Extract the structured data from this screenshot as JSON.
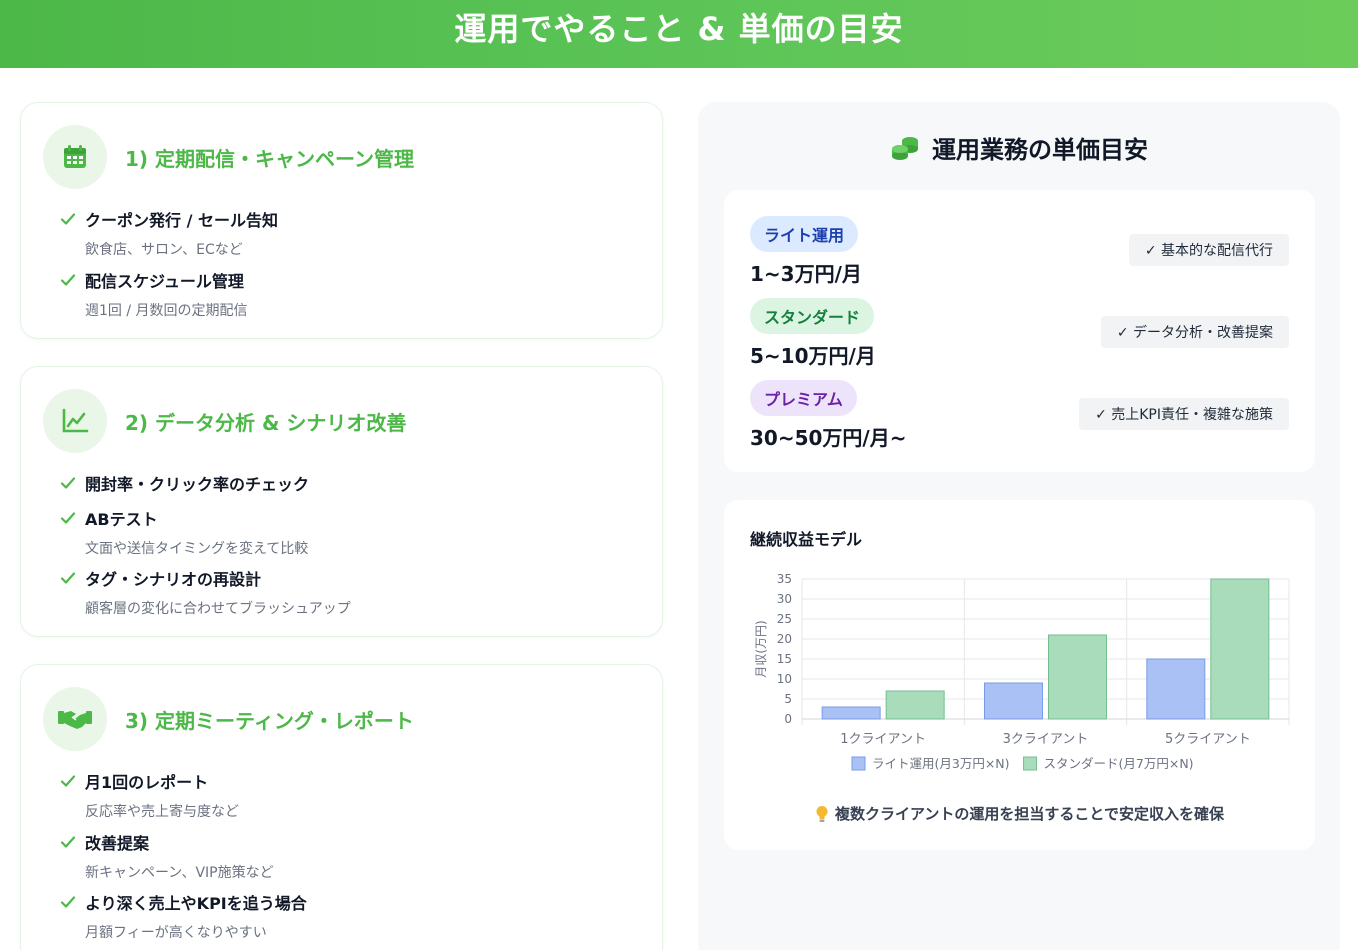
{
  "header": {
    "title": "運用でやること & 単価の目安"
  },
  "sections": [
    {
      "title": "1) 定期配信・キャンペーン管理",
      "icon": "calendar-icon",
      "items": [
        {
          "title": "クーポン発行 / セール告知",
          "sub": "飲食店、サロン、ECなど"
        },
        {
          "title": "配信スケジュール管理",
          "sub": "週1回 / 月数回の定期配信"
        }
      ]
    },
    {
      "title": "2) データ分析 & シナリオ改善",
      "icon": "line-chart-icon",
      "items": [
        {
          "title": "開封率・クリック率のチェック",
          "sub": ""
        },
        {
          "title": "ABテスト",
          "sub": "文面や送信タイミングを変えて比較"
        },
        {
          "title": "タグ・シナリオの再設計",
          "sub": "顧客層の変化に合わせてブラッシュアップ"
        }
      ]
    },
    {
      "title": "3) 定期ミーティング・レポート",
      "icon": "handshake-icon",
      "items": [
        {
          "title": "月1回のレポート",
          "sub": "反応率や売上寄与度など"
        },
        {
          "title": "改善提案",
          "sub": "新キャンペーン、VIP施策など"
        },
        {
          "title": "より深く売上やKPIを追う場合",
          "sub": "月額フィーが高くなりやすい"
        }
      ]
    }
  ],
  "pricing": {
    "title": "運用業務の単価目安",
    "icon": "coins-icon",
    "tiers": [
      {
        "name": "ライト運用",
        "price": "1~3万円/月",
        "desc": "✓ 基本的な配信代行",
        "bg": "#dbeafe",
        "fg": "#1e40af"
      },
      {
        "name": "スタンダード",
        "price": "5~10万円/月",
        "desc": "✓ データ分析・改善提案",
        "bg": "#dcf5e3",
        "fg": "#15803d"
      },
      {
        "name": "プレミアム",
        "price": "30~50万円/月~",
        "desc": "✓ 売上KPI責任・複雑な施策",
        "bg": "#ede4fb",
        "fg": "#6b21a8"
      }
    ]
  },
  "chart_data": {
    "type": "bar",
    "title": "継続収益モデル",
    "ylabel": "月収(万円)",
    "xlabel": "",
    "categories": [
      "1クライアント",
      "3クライアント",
      "5クライアント"
    ],
    "series": [
      {
        "name": "ライト運用(月3万円×N)",
        "values": [
          3,
          9,
          15
        ],
        "fill": "#a9c1f5",
        "stroke": "#7b9be8"
      },
      {
        "name": "スタンダード(月7万円×N)",
        "values": [
          7,
          21,
          35
        ],
        "fill": "#a8dcba",
        "stroke": "#73c08e"
      }
    ],
    "ylim": [
      0,
      35
    ],
    "yticks": [
      0,
      5,
      10,
      15,
      20,
      25,
      30,
      35
    ],
    "grid": true,
    "legend": "bottom"
  },
  "note": {
    "text": "複数クライアントの運用を担当することで安定収入を確保",
    "icon": "lightbulb-icon"
  }
}
